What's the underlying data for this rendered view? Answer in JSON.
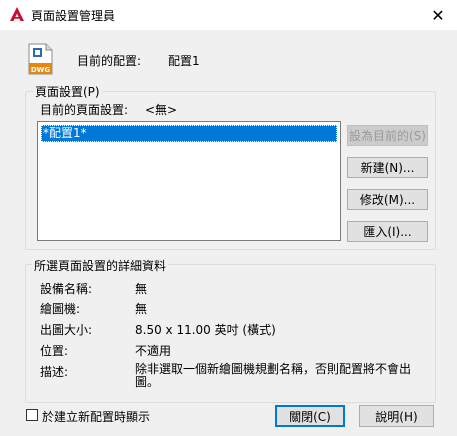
{
  "window": {
    "title": "頁面設置管理員"
  },
  "current": {
    "label": "目前的配置:",
    "value": "配置1"
  },
  "page_setups": {
    "legend": "頁面設置(P)",
    "current_label": "目前的頁面設置:",
    "current_value": "<無>",
    "items": [
      "*配置1*"
    ]
  },
  "buttons": {
    "set_current": "設為目前的(S)",
    "new": "新建(N)...",
    "modify": "修改(M)...",
    "import": "匯入(I)...",
    "close": "關閉(C)",
    "help": "說明(H)"
  },
  "details": {
    "legend": "所選頁面設置的詳細資料",
    "rows": [
      {
        "label": "設備名稱:",
        "value": "無"
      },
      {
        "label": "繪圖機:",
        "value": "無"
      },
      {
        "label": "出圖大小:",
        "value": "8.50 x 11.00 英吋 (橫式)"
      },
      {
        "label": "位置:",
        "value": "不適用"
      },
      {
        "label": "描述:",
        "value": "除非選取一個新繪圖機規劃名稱，否則配置將不會出圖。"
      }
    ]
  },
  "show_on_create": {
    "label": "於建立新配置時顯示",
    "checked": false
  },
  "colors": {
    "accent": "#0078d7",
    "autocad_red": "#c8102e"
  },
  "icons": {
    "app": "autocad-logo-icon",
    "close": "close-icon",
    "dwg": "dwg-file-icon"
  }
}
